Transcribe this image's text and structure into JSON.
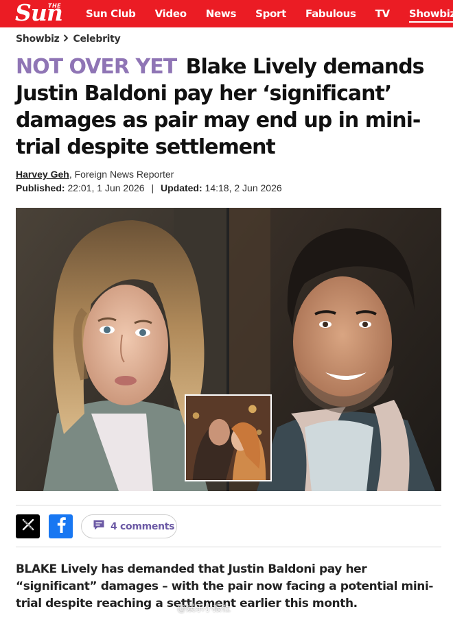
{
  "header": {
    "logo_the": "THE",
    "logo_sun": "Sun",
    "nav": [
      "Sun Club",
      "Video",
      "News",
      "Sport",
      "Fabulous",
      "TV",
      "Showbiz"
    ],
    "active_nav": "Showbiz",
    "brand_color": "#eb1c24"
  },
  "breadcrumb": {
    "section": "Showbiz",
    "subsection": "Celebrity"
  },
  "article": {
    "kicker": "NOT OVER YET",
    "headline": "Blake Lively demands Justin Baldoni pay her ‘significant’ damages as pair may end up in mini-trial despite settlement",
    "kicker_color": "#8f75b5",
    "author": "Harvey Geh",
    "author_role": ", Foreign News Reporter",
    "published_label": "Published:",
    "published": "22:01, 1 Jun 2026",
    "updated_label": "Updated:",
    "updated": "14:18, 2 Jun 2026",
    "standfirst": "BLAKE Lively has demanded that Justin Baldoni pay her “significant” damages – with the pair now facing a potential mini-trial despite reaching a settlement earlier this month."
  },
  "share": {
    "x_icon": "x-logo-icon",
    "facebook_icon": "facebook-icon",
    "comments_label": "4 comments",
    "comments_icon": "comment-icon"
  },
  "watermark": "@娱乐小报社"
}
